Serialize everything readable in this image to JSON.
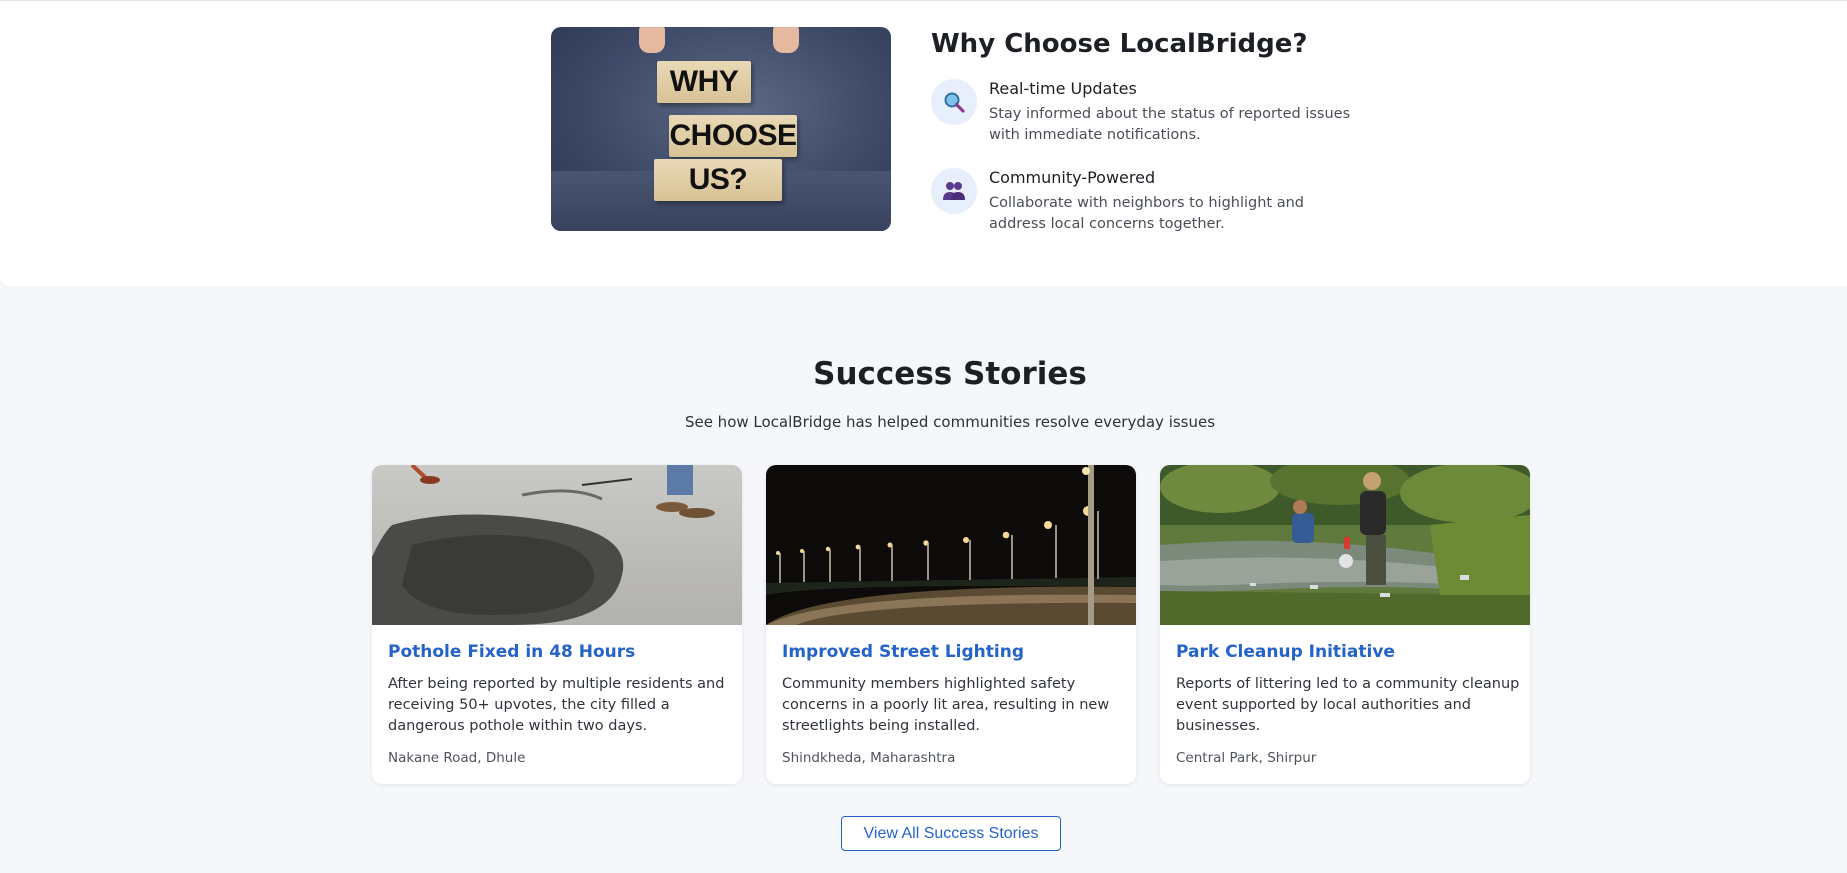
{
  "why_section": {
    "image_words": [
      "WHY",
      "CHOOSE",
      "US?"
    ],
    "heading": "Why Choose LocalBridge?",
    "features": [
      {
        "icon": "magnifier-icon",
        "title": "Real-time Updates",
        "description": "Stay informed about the status of reported issues with immediate notifications."
      },
      {
        "icon": "people-icon",
        "title": "Community-Powered",
        "description": "Collaborate with neighbors to highlight and address local concerns together."
      }
    ]
  },
  "success_stories": {
    "title": "Success Stories",
    "subtitle": "See how LocalBridge has helped communities resolve everyday issues",
    "cards": [
      {
        "image": "pothole-repair-photo",
        "title": "Pothole Fixed in 48 Hours",
        "description": "After being reported by multiple residents and receiving 50+ upvotes, the city filled a dangerous pothole within two days.",
        "location": "Nakane Road, Dhule"
      },
      {
        "image": "street-lights-photo",
        "title": "Improved Street Lighting",
        "description": "Community members highlighted safety concerns in a poorly lit area, resulting in new streetlights being installed.",
        "location": "Shindkheda, Maharashtra"
      },
      {
        "image": "park-cleanup-photo",
        "title": "Park Cleanup Initiative",
        "description": "Reports of littering led to a community cleanup event supported by local authorities and businesses.",
        "location": "Central Park, Shirpur"
      }
    ],
    "view_all_label": "View All Success Stories"
  },
  "colors": {
    "accent": "#2563c9",
    "page_background": "#f5f7fa",
    "card_background": "#ffffff"
  }
}
